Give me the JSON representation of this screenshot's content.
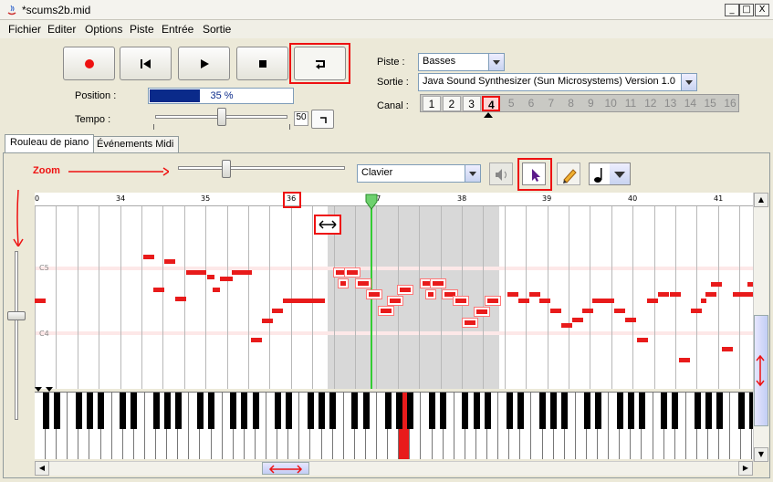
{
  "window": {
    "title": "*scums2b.mid",
    "buttons": {
      "minimize": "_",
      "maximize": "□",
      "close": "X"
    }
  },
  "menu": [
    "Fichier",
    "Editer",
    "Options",
    "Piste",
    "Entrée",
    "Sortie"
  ],
  "transport": {
    "position_label": "Position :",
    "position_value": "35 %",
    "position_progress": 0.35,
    "tempo_label": "Tempo :",
    "tempo_value": "50"
  },
  "track": {
    "piste_label": "Piste :",
    "piste_value": "Basses",
    "sortie_label": "Sortie :",
    "sortie_value": "Java Sound Synthesizer (Sun Microsystems) Version 1.0",
    "canal_label": "Canal :",
    "channels": [
      "1",
      "2",
      "3",
      "4",
      "5",
      "6",
      "7",
      "8",
      "9",
      "10",
      "11",
      "12",
      "13",
      "14",
      "15",
      "16"
    ],
    "selected_channel": "4"
  },
  "tabs": [
    "Rouleau de piano",
    "Événements Midi"
  ],
  "editor": {
    "instrument": "Clavier",
    "zoom_annotation": "Zoom"
  },
  "ruler": {
    "ticks": [
      "0",
      "34",
      "35",
      "36",
      "37",
      "38",
      "39",
      "40",
      "41"
    ]
  },
  "grid": {
    "octave_labels": [
      "C5",
      "C4"
    ]
  },
  "colors": {
    "note": "#e81b1b",
    "accent": "#e11111",
    "progress": "#0a2a8a",
    "playhead": "#33cc33"
  }
}
